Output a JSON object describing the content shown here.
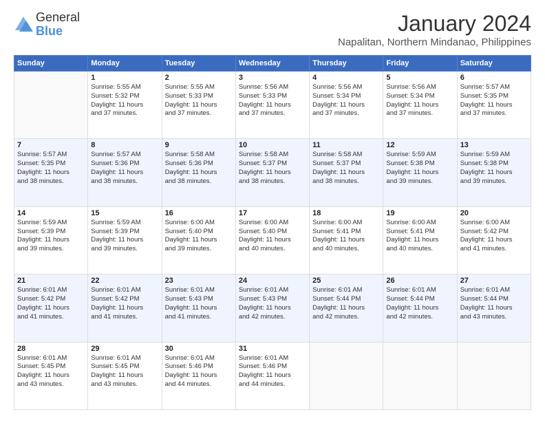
{
  "header": {
    "logo_line1": "General",
    "logo_line2": "Blue",
    "title": "January 2024",
    "subtitle": "Napalitan, Northern Mindanao, Philippines"
  },
  "calendar": {
    "days_of_week": [
      "Sunday",
      "Monday",
      "Tuesday",
      "Wednesday",
      "Thursday",
      "Friday",
      "Saturday"
    ],
    "weeks": [
      [
        {
          "day": "",
          "info": ""
        },
        {
          "day": "1",
          "info": "Sunrise: 5:55 AM\nSunset: 5:32 PM\nDaylight: 11 hours\nand 37 minutes."
        },
        {
          "day": "2",
          "info": "Sunrise: 5:55 AM\nSunset: 5:33 PM\nDaylight: 11 hours\nand 37 minutes."
        },
        {
          "day": "3",
          "info": "Sunrise: 5:56 AM\nSunset: 5:33 PM\nDaylight: 11 hours\nand 37 minutes."
        },
        {
          "day": "4",
          "info": "Sunrise: 5:56 AM\nSunset: 5:34 PM\nDaylight: 11 hours\nand 37 minutes."
        },
        {
          "day": "5",
          "info": "Sunrise: 5:56 AM\nSunset: 5:34 PM\nDaylight: 11 hours\nand 37 minutes."
        },
        {
          "day": "6",
          "info": "Sunrise: 5:57 AM\nSunset: 5:35 PM\nDaylight: 11 hours\nand 37 minutes."
        }
      ],
      [
        {
          "day": "7",
          "info": "Sunrise: 5:57 AM\nSunset: 5:35 PM\nDaylight: 11 hours\nand 38 minutes."
        },
        {
          "day": "8",
          "info": "Sunrise: 5:57 AM\nSunset: 5:36 PM\nDaylight: 11 hours\nand 38 minutes."
        },
        {
          "day": "9",
          "info": "Sunrise: 5:58 AM\nSunset: 5:36 PM\nDaylight: 11 hours\nand 38 minutes."
        },
        {
          "day": "10",
          "info": "Sunrise: 5:58 AM\nSunset: 5:37 PM\nDaylight: 11 hours\nand 38 minutes."
        },
        {
          "day": "11",
          "info": "Sunrise: 5:58 AM\nSunset: 5:37 PM\nDaylight: 11 hours\nand 38 minutes."
        },
        {
          "day": "12",
          "info": "Sunrise: 5:59 AM\nSunset: 5:38 PM\nDaylight: 11 hours\nand 39 minutes."
        },
        {
          "day": "13",
          "info": "Sunrise: 5:59 AM\nSunset: 5:38 PM\nDaylight: 11 hours\nand 39 minutes."
        }
      ],
      [
        {
          "day": "14",
          "info": "Sunrise: 5:59 AM\nSunset: 5:39 PM\nDaylight: 11 hours\nand 39 minutes."
        },
        {
          "day": "15",
          "info": "Sunrise: 5:59 AM\nSunset: 5:39 PM\nDaylight: 11 hours\nand 39 minutes."
        },
        {
          "day": "16",
          "info": "Sunrise: 6:00 AM\nSunset: 5:40 PM\nDaylight: 11 hours\nand 39 minutes."
        },
        {
          "day": "17",
          "info": "Sunrise: 6:00 AM\nSunset: 5:40 PM\nDaylight: 11 hours\nand 40 minutes."
        },
        {
          "day": "18",
          "info": "Sunrise: 6:00 AM\nSunset: 5:41 PM\nDaylight: 11 hours\nand 40 minutes."
        },
        {
          "day": "19",
          "info": "Sunrise: 6:00 AM\nSunset: 5:41 PM\nDaylight: 11 hours\nand 40 minutes."
        },
        {
          "day": "20",
          "info": "Sunrise: 6:00 AM\nSunset: 5:42 PM\nDaylight: 11 hours\nand 41 minutes."
        }
      ],
      [
        {
          "day": "21",
          "info": "Sunrise: 6:01 AM\nSunset: 5:42 PM\nDaylight: 11 hours\nand 41 minutes."
        },
        {
          "day": "22",
          "info": "Sunrise: 6:01 AM\nSunset: 5:42 PM\nDaylight: 11 hours\nand 41 minutes."
        },
        {
          "day": "23",
          "info": "Sunrise: 6:01 AM\nSunset: 5:43 PM\nDaylight: 11 hours\nand 41 minutes."
        },
        {
          "day": "24",
          "info": "Sunrise: 6:01 AM\nSunset: 5:43 PM\nDaylight: 11 hours\nand 42 minutes."
        },
        {
          "day": "25",
          "info": "Sunrise: 6:01 AM\nSunset: 5:44 PM\nDaylight: 11 hours\nand 42 minutes."
        },
        {
          "day": "26",
          "info": "Sunrise: 6:01 AM\nSunset: 5:44 PM\nDaylight: 11 hours\nand 42 minutes."
        },
        {
          "day": "27",
          "info": "Sunrise: 6:01 AM\nSunset: 5:44 PM\nDaylight: 11 hours\nand 43 minutes."
        }
      ],
      [
        {
          "day": "28",
          "info": "Sunrise: 6:01 AM\nSunset: 5:45 PM\nDaylight: 11 hours\nand 43 minutes."
        },
        {
          "day": "29",
          "info": "Sunrise: 6:01 AM\nSunset: 5:45 PM\nDaylight: 11 hours\nand 43 minutes."
        },
        {
          "day": "30",
          "info": "Sunrise: 6:01 AM\nSunset: 5:46 PM\nDaylight: 11 hours\nand 44 minutes."
        },
        {
          "day": "31",
          "info": "Sunrise: 6:01 AM\nSunset: 5:46 PM\nDaylight: 11 hours\nand 44 minutes."
        },
        {
          "day": "",
          "info": ""
        },
        {
          "day": "",
          "info": ""
        },
        {
          "day": "",
          "info": ""
        }
      ]
    ]
  }
}
